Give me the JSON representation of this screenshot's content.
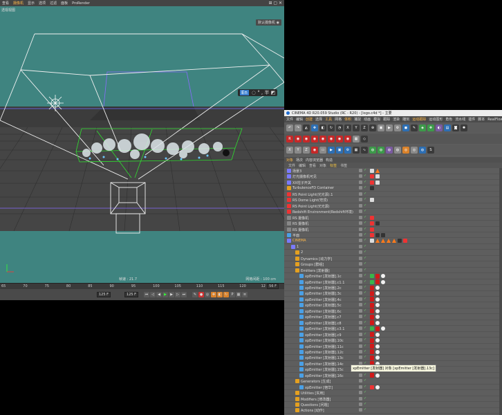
{
  "viewport": {
    "menu": [
      "查看",
      "摄像机",
      "显示",
      "选项",
      "过滤",
      "面板",
      "ProRender"
    ],
    "active_menu_index": 1,
    "view_label": "透视视图",
    "display_label": "默认摄像机 ◉",
    "fps_label": "帧速 : 21.7",
    "grid_label": "网格间距 : 100 cm",
    "window_controls": "⊞ ▢ ✕",
    "ime": {
      "mode": "En",
      "symbols": "◌ ° , 半 ◩"
    }
  },
  "timeline": {
    "ticks": [
      "65",
      "70",
      "75",
      "80",
      "85",
      "90",
      "95",
      "100",
      "105",
      "110",
      "115",
      "120",
      "12"
    ],
    "frame_field": "56 F",
    "start_field": "125 F",
    "end_field": "125 F"
  },
  "c4d": {
    "title": "CINEMA 4D R20.059 Studio (RC - R20) - [logo.c4d *] - 主要",
    "menu": [
      "文件",
      "编辑",
      "创建",
      "选择",
      "工具",
      "网格",
      "体积",
      "捕捉",
      "动画",
      "模拟",
      "跟踪",
      "渲染",
      "雕刻",
      "运动跟踪",
      "运动图形",
      "角色",
      "流水线",
      "插件",
      "脚本",
      "RealFlow"
    ],
    "highlighted_menu": [
      2,
      4,
      6,
      13
    ],
    "tabs": [
      "对象",
      "场次",
      "内容浏览器",
      "构造"
    ],
    "active_tab_index": 0,
    "om_menu": [
      "文件",
      "编辑",
      "查看",
      "对象",
      "标签",
      "书签"
    ],
    "highlighted_om_menu": 4,
    "tooltip": "xpEmitter [发射器] 对象 [xpEmitter [发射器].13c]",
    "toolbar1": [
      {
        "icon": "undo-icon",
        "color": "gray",
        "glyph": "↶"
      },
      {
        "icon": "redo-icon",
        "color": "gray",
        "glyph": "↷"
      },
      {
        "icon": "select-icon",
        "color": "dark",
        "glyph": "◭"
      },
      {
        "icon": "move-icon",
        "color": "blue",
        "glyph": "✥"
      },
      {
        "icon": "scale-icon",
        "color": "dark",
        "glyph": "◧"
      },
      {
        "icon": "rotate-icon",
        "color": "dark",
        "glyph": "↻"
      },
      {
        "icon": "recent-icon",
        "color": "dark",
        "glyph": "◔"
      },
      {
        "icon": "x-axis-icon",
        "color": "dark",
        "glyph": "X"
      },
      {
        "icon": "y-axis-icon",
        "color": "dark",
        "glyph": "Y"
      },
      {
        "icon": "z-axis-icon",
        "color": "dark",
        "glyph": "Z"
      },
      {
        "icon": "coord-icon",
        "color": "dark",
        "glyph": "⊕"
      },
      {
        "icon": "render-region-icon",
        "color": "gray",
        "glyph": "▣"
      },
      {
        "icon": "render-view-icon",
        "color": "gray",
        "glyph": "▶"
      },
      {
        "icon": "render-settings-icon",
        "color": "gray",
        "glyph": "⚙"
      },
      {
        "icon": "cube-icon",
        "color": "blue",
        "glyph": "◼"
      },
      {
        "icon": "pen-icon",
        "color": "dark",
        "glyph": "✎"
      },
      {
        "icon": "subdiv-icon",
        "color": "green",
        "glyph": "◈"
      },
      {
        "icon": "cloner-icon",
        "color": "green",
        "glyph": "❖"
      },
      {
        "icon": "deformer-icon",
        "color": "purple",
        "glyph": "◐"
      },
      {
        "icon": "floor-icon",
        "color": "blue",
        "glyph": "▤"
      },
      {
        "icon": "camera-icon",
        "color": "dark",
        "glyph": "◙"
      },
      {
        "icon": "light-icon",
        "color": "dark",
        "glyph": "✺"
      }
    ],
    "toolbar2": [
      {
        "icon": "redshift-icon",
        "color": "red",
        "glyph": "R"
      },
      {
        "icon": "redshift-render-icon",
        "color": "red",
        "glyph": "◉"
      },
      {
        "icon": "redshift-ipr-icon",
        "color": "red",
        "glyph": "◉"
      },
      {
        "icon": "redshift-light-icon",
        "color": "red",
        "glyph": "◉"
      },
      {
        "icon": "redshift-dome-icon",
        "color": "red",
        "glyph": "◉"
      },
      {
        "icon": "redshift-proxy-icon",
        "color": "red",
        "glyph": "◉"
      },
      {
        "icon": "redshift-volume-icon",
        "color": "red",
        "glyph": "◉"
      },
      {
        "icon": "redshift-env-icon",
        "color": "red",
        "glyph": "◉"
      },
      {
        "icon": "redshift-settings-icon",
        "color": "gray",
        "glyph": "▦"
      },
      {
        "icon": "turbulence-icon",
        "color": "dark",
        "glyph": "◇"
      }
    ],
    "toolbar3": [
      {
        "icon": "x-lock-icon",
        "color": "gray",
        "glyph": "X"
      },
      {
        "icon": "y-lock-icon",
        "color": "gray",
        "glyph": "Y"
      },
      {
        "icon": "z-lock-icon",
        "color": "gray",
        "glyph": "Z"
      },
      {
        "icon": "world-coord-icon",
        "color": "red",
        "glyph": "◉"
      },
      {
        "icon": "frame-icon",
        "color": "gray",
        "glyph": "▭"
      },
      {
        "icon": "render-active-icon",
        "color": "blue",
        "glyph": "▶"
      },
      {
        "icon": "picture-viewer-icon",
        "color": "blue",
        "glyph": "▣"
      },
      {
        "icon": "edit-render-icon",
        "color": "blue",
        "glyph": "⚙"
      },
      {
        "icon": "mesh-icon",
        "color": "dark",
        "glyph": "▦"
      },
      {
        "icon": "spline-icon",
        "color": "dark",
        "glyph": "∿"
      },
      {
        "icon": "nurbs-icon",
        "color": "green",
        "glyph": "◍"
      },
      {
        "icon": "array-icon",
        "color": "green",
        "glyph": "◍"
      },
      {
        "icon": "generator-icon",
        "color": "purple",
        "glyph": "◍"
      },
      {
        "icon": "sky-icon",
        "color": "gray",
        "glyph": "◍"
      },
      {
        "icon": "bulb-icon",
        "color": "orange",
        "glyph": "◎"
      },
      {
        "icon": "target-icon",
        "color": "gray",
        "glyph": "◎"
      },
      {
        "icon": "material-icon",
        "color": "blue",
        "glyph": "◍"
      },
      {
        "icon": "python-icon",
        "color": "dark",
        "glyph": "S"
      }
    ],
    "objects": [
      {
        "name": "场景3",
        "indent": 0,
        "icon": "#7a7aff",
        "tags": [
          "dots",
          "orange-tri"
        ]
      },
      {
        "name": "灯光摄像机可见",
        "indent": 0,
        "icon": "#7a7aff",
        "tags": [
          "orange-sq",
          "dots"
        ]
      },
      {
        "name": "XX柱子开关",
        "indent": 0,
        "icon": "#7a7aff",
        "tags": [
          "orange-sq",
          "dots"
        ]
      },
      {
        "name": "TurbulenceFD Container",
        "indent": 0,
        "icon": "#e4a020",
        "tags": [
          "dark"
        ]
      },
      {
        "name": "RS Point Light(光光源).1",
        "indent": 0,
        "icon": "#e33",
        "tags": []
      },
      {
        "name": "RS Dome Light(穹顶)",
        "indent": 0,
        "icon": "#e33",
        "tags": [
          "check"
        ]
      },
      {
        "name": "RS Point Light(光光源)",
        "indent": 0,
        "icon": "#e33",
        "tags": []
      },
      {
        "name": "Redshift Environment(Redshift环境)",
        "indent": 0,
        "icon": "#e33",
        "tags": []
      },
      {
        "name": "RS 摄像机",
        "indent": 0,
        "icon": "#888",
        "tags": [
          "red"
        ]
      },
      {
        "name": "RS 摄像机",
        "indent": 0,
        "icon": "#888",
        "tags": [
          "red",
          "dark"
        ]
      },
      {
        "name": "RS 摄像机",
        "indent": 0,
        "icon": "#888",
        "tags": [
          "red"
        ]
      },
      {
        "name": "平面",
        "indent": 0,
        "icon": "#4aa0e6",
        "tags": [
          "red",
          "dark",
          "dark"
        ]
      },
      {
        "name": "CINEMA",
        "indent": 0,
        "icon": "#7a7aff",
        "tags": [
          "dots",
          "orange-tri",
          "orange-tri",
          "orange-tri",
          "orange-tri",
          "dark",
          "red"
        ]
      },
      {
        "name": "1",
        "indent": 1,
        "icon": "#7a7aff",
        "tags": []
      },
      {
        "name": "2",
        "indent": 2,
        "icon": "#e4a020",
        "tags": []
      },
      {
        "name": "Dynamics [动力学]",
        "indent": 2,
        "icon": "#e4a020",
        "tags": []
      },
      {
        "name": "Groups [群组]",
        "indent": 2,
        "icon": "#e4a020",
        "tags": []
      },
      {
        "name": "Emitters [发射器]",
        "indent": 2,
        "icon": "#e4a020",
        "tags": []
      },
      {
        "name": "xpEmitter [发射器].1c",
        "indent": 3,
        "icon": "#4aa0e6",
        "tags": [
          "green",
          "redsq",
          "white"
        ]
      },
      {
        "name": "xpEmitter [发射器].c1.1",
        "indent": 3,
        "icon": "#4aa0e6",
        "tags": [
          "green",
          "redsq",
          "white"
        ]
      },
      {
        "name": "xpEmitter [发射器].2c",
        "indent": 3,
        "icon": "#4aa0e6",
        "tags": [
          "redsq",
          "white"
        ]
      },
      {
        "name": "xpEmitter [发射器].3c",
        "indent": 3,
        "icon": "#4aa0e6",
        "tags": [
          "redsq",
          "white"
        ]
      },
      {
        "name": "xpEmitter [发射器].4c",
        "indent": 3,
        "icon": "#4aa0e6",
        "tags": [
          "redsq",
          "white"
        ]
      },
      {
        "name": "xpEmitter [发射器].5c",
        "indent": 3,
        "icon": "#4aa0e6",
        "tags": [
          "redsq",
          "white"
        ]
      },
      {
        "name": "xpEmitter [发射器].6c",
        "indent": 3,
        "icon": "#4aa0e6",
        "tags": [
          "redsq",
          "white"
        ]
      },
      {
        "name": "xpEmitter [发射器].c7",
        "indent": 3,
        "icon": "#4aa0e6",
        "tags": [
          "redsq",
          "white"
        ]
      },
      {
        "name": "xpEmitter [发射器].c8",
        "indent": 3,
        "icon": "#4aa0e6",
        "tags": [
          "redsq",
          "white"
        ]
      },
      {
        "name": "xpEmitter [发射器].c3.1",
        "indent": 3,
        "icon": "#4aa0e6",
        "tags": [
          "green",
          "redsq",
          "white"
        ]
      },
      {
        "name": "xpEmitter [发射器].c9",
        "indent": 3,
        "icon": "#4aa0e6",
        "tags": [
          "redsq",
          "white"
        ]
      },
      {
        "name": "xpEmitter [发射器].10c",
        "indent": 3,
        "icon": "#4aa0e6",
        "tags": [
          "redsq",
          "white"
        ]
      },
      {
        "name": "xpEmitter [发射器].11c",
        "indent": 3,
        "icon": "#4aa0e6",
        "tags": [
          "redsq",
          "white"
        ]
      },
      {
        "name": "xpEmitter [发射器].12c",
        "indent": 3,
        "icon": "#4aa0e6",
        "tags": [
          "redsq",
          "white"
        ]
      },
      {
        "name": "xpEmitter [发射器].13c",
        "indent": 3,
        "icon": "#4aa0e6",
        "tags": [
          "redsq",
          "white"
        ]
      },
      {
        "name": "xpEmitter [发射器].14c",
        "indent": 3,
        "icon": "#4aa0e6",
        "tags": [
          "redsq",
          "white"
        ]
      },
      {
        "name": "xpEmitter [发射器].15c",
        "indent": 3,
        "icon": "#4aa0e6",
        "tags": [
          "redsq",
          "white"
        ]
      },
      {
        "name": "xpEmitter [发射器].16c",
        "indent": 3,
        "icon": "#4aa0e6",
        "tags": [
          "redsq",
          "white"
        ]
      },
      {
        "name": "Generators [生成]",
        "indent": 2,
        "icon": "#e4a020",
        "tags": []
      },
      {
        "name": "xpEmitter [宿华]",
        "indent": 3,
        "icon": "#4aa0e6",
        "tags": [
          "red",
          "white"
        ]
      },
      {
        "name": "Utilities [实用]",
        "indent": 2,
        "icon": "#e4a020",
        "tags": []
      },
      {
        "name": "Modifiers [修改器]",
        "indent": 2,
        "icon": "#e4a020",
        "tags": []
      },
      {
        "name": "Questions [问题]",
        "indent": 2,
        "icon": "#e4a020",
        "tags": []
      },
      {
        "name": "Actions [动作]",
        "indent": 2,
        "icon": "#e4a020",
        "tags": []
      }
    ]
  }
}
